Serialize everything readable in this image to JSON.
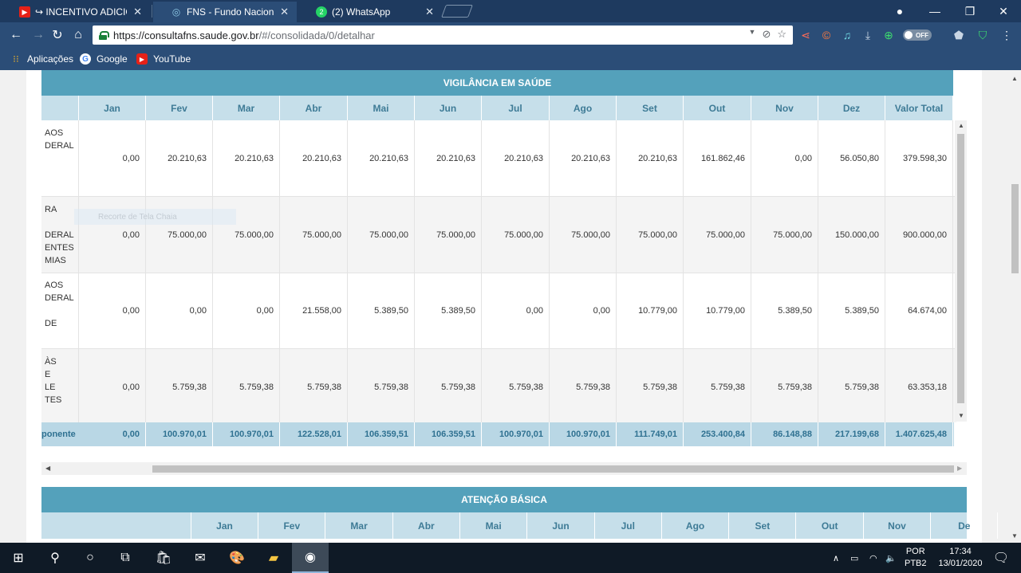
{
  "browser": {
    "tabs": [
      {
        "title": "INCENTIVO ADICIONA",
        "prefix": "↪",
        "active": false,
        "favicon": "youtube-icon"
      },
      {
        "title": "FNS - Fundo Nacional de",
        "active": true,
        "favicon": "fns-icon"
      },
      {
        "title": "(2) WhatsApp",
        "active": false,
        "favicon": "whatsapp-icon",
        "badge": "2"
      }
    ],
    "url_host": "https://consultafns.saude.gov.br",
    "url_path": "/#/consolidada/0/detalhar",
    "off_label": "OFF",
    "bookmarks": [
      {
        "label": "Aplicações",
        "icon": "apps-grid-icon"
      },
      {
        "label": "Google",
        "icon": "google-icon"
      },
      {
        "label": "YouTube",
        "icon": "youtube-icon"
      }
    ]
  },
  "section1": {
    "title": "VIGILÂNCIA EM SAÚDE",
    "months": [
      "Jan",
      "Fev",
      "Mar",
      "Abr",
      "Mai",
      "Jun",
      "Jul",
      "Ago",
      "Set",
      "Out",
      "Nov",
      "Dez",
      "Valor Total"
    ],
    "rows": [
      {
        "label_lines": [
          "AOS",
          "DERAL"
        ],
        "values": [
          "0,00",
          "20.210,63",
          "20.210,63",
          "20.210,63",
          "20.210,63",
          "20.210,63",
          "20.210,63",
          "20.210,63",
          "20.210,63",
          "161.862,46",
          "0,00",
          "56.050,80",
          "379.598,30"
        ]
      },
      {
        "label_lines": [
          "RA",
          "",
          "DERAL",
          "ENTES",
          "MIAS"
        ],
        "values": [
          "0,00",
          "75.000,00",
          "75.000,00",
          "75.000,00",
          "75.000,00",
          "75.000,00",
          "75.000,00",
          "75.000,00",
          "75.000,00",
          "75.000,00",
          "75.000,00",
          "150.000,00",
          "900.000,00"
        ]
      },
      {
        "label_lines": [
          "AOS",
          "DERAL",
          "",
          "DE"
        ],
        "values": [
          "0,00",
          "0,00",
          "0,00",
          "21.558,00",
          "5.389,50",
          "5.389,50",
          "0,00",
          "0,00",
          "10.779,00",
          "10.779,00",
          "5.389,50",
          "5.389,50",
          "64.674,00"
        ]
      },
      {
        "label_lines": [
          "ÀS",
          "E",
          "LE",
          "TES"
        ],
        "values": [
          "0,00",
          "5.759,38",
          "5.759,38",
          "5.759,38",
          "5.759,38",
          "5.759,38",
          "5.759,38",
          "5.759,38",
          "5.759,38",
          "5.759,38",
          "5.759,38",
          "5.759,38",
          "63.353,18"
        ]
      }
    ],
    "totals_label": "ponente",
    "totals": [
      "0,00",
      "100.970,01",
      "100.970,01",
      "122.528,01",
      "106.359,51",
      "106.359,51",
      "100.970,01",
      "100.970,01",
      "111.749,01",
      "253.400,84",
      "86.148,88",
      "217.199,68",
      "1.407.625,48"
    ],
    "overlay_text": "Recorte de Tela Chaia"
  },
  "section2": {
    "title": "ATENÇÃO BÁSICA",
    "months": [
      "Jan",
      "Fev",
      "Mar",
      "Abr",
      "Mai",
      "Jun",
      "Jul",
      "Ago",
      "Set",
      "Out",
      "Nov",
      "De"
    ]
  },
  "taskbar": {
    "lang": "POR",
    "layout": "PTB2",
    "time": "17:34",
    "date": "13/01/2020"
  }
}
